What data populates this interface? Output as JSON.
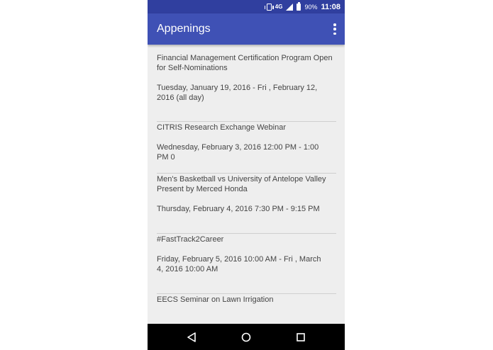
{
  "status_bar": {
    "network": "4G",
    "battery": "90%",
    "time": "11:08"
  },
  "app_bar": {
    "title": "Appenings",
    "menu_icon": "overflow-menu-icon"
  },
  "events": [
    {
      "title": "Financial Management Certification Program Open for Self-Nominations",
      "date": "Tuesday, January 19, 2016  - Fri , February 12, 2016 (all day)"
    },
    {
      "title": "CITRIS Research Exchange Webinar",
      "date": "Wednesday, February 3, 2016 12:00 PM - 1:00 PM 0"
    },
    {
      "title": "Men's Basketball vs University of Antelope Valley Present by Merced Honda",
      "date": "Thursday, February 4, 2016 7:30 PM - 9:15 PM"
    },
    {
      "title": "#FastTrack2Career",
      "date": "Friday, February 5, 2016 10:00 AM - Fri , March 4, 2016 10:00 AM"
    },
    {
      "title": "EECS Seminar on Lawn Irrigation",
      "date": ""
    }
  ],
  "nav_bar": {
    "back": "back-icon",
    "home": "home-icon",
    "recent": "recent-apps-icon"
  },
  "colors": {
    "primary": "#3f51b5",
    "primary_dark": "#303f9f",
    "background": "#eeeeee"
  }
}
